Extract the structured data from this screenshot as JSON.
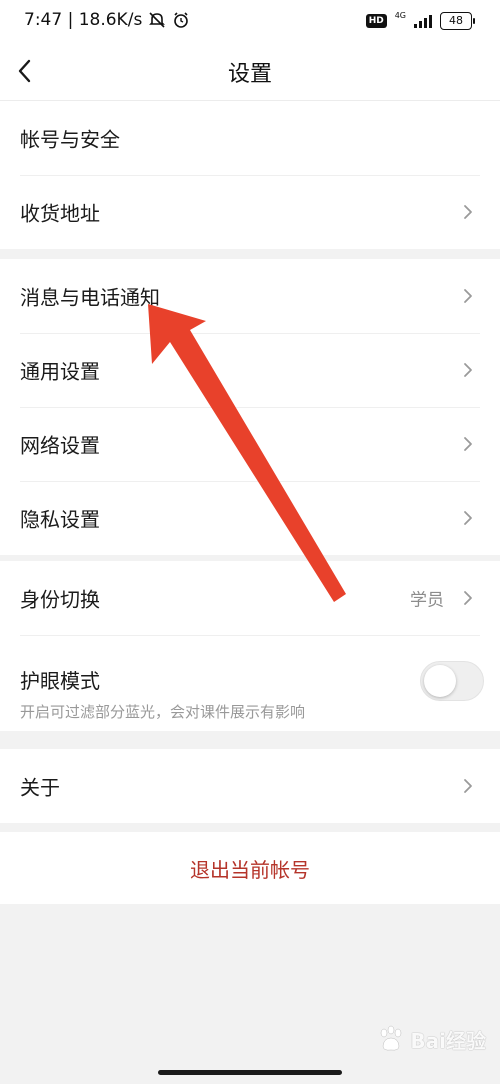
{
  "status_bar": {
    "time_speed": "7:47 | 18.6K/s",
    "hd_label": "HD",
    "network_label": "4G",
    "battery_level": "48"
  },
  "header": {
    "title": "设置"
  },
  "groups": [
    [
      {
        "label": "帐号与安全"
      },
      {
        "label": "收货地址"
      }
    ],
    [
      {
        "label": "消息与电话通知"
      },
      {
        "label": "通用设置"
      },
      {
        "label": "网络设置"
      },
      {
        "label": "隐私设置"
      }
    ],
    [
      {
        "label": "身份切换",
        "value": "学员"
      },
      {
        "label": "护眼模式",
        "description": "开启可过滤部分蓝光，会对课件展示有影响",
        "toggle_on": false
      }
    ],
    [
      {
        "label": "关于"
      }
    ]
  ],
  "logout": {
    "label": "退出当前帐号"
  },
  "watermark": {
    "text": "Bai经验"
  },
  "colors": {
    "annotation_arrow": "#e8412b",
    "logout_text": "#b5342a"
  }
}
